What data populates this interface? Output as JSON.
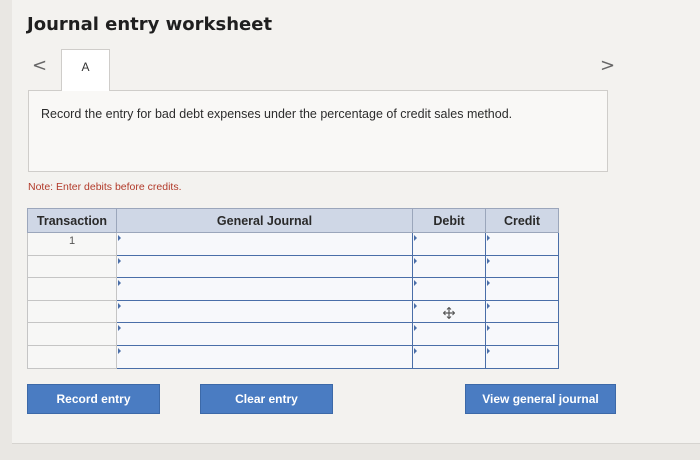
{
  "worksheet": {
    "title": "Journal entry worksheet",
    "prev_arrow": "<",
    "next_arrow": ">",
    "tab_label": "A",
    "prompt": "Record the entry for bad debt expenses under the percentage of credit sales method.",
    "note": "Note: Enter debits before credits."
  },
  "table": {
    "headers": [
      "Transaction",
      "General Journal",
      "Debit",
      "Credit"
    ],
    "rows": [
      {
        "transaction": "1",
        "account": "",
        "debit": "",
        "credit": ""
      },
      {
        "transaction": "",
        "account": "",
        "debit": "",
        "credit": ""
      },
      {
        "transaction": "",
        "account": "",
        "debit": "",
        "credit": ""
      },
      {
        "transaction": "",
        "account": "",
        "debit": "",
        "credit": ""
      },
      {
        "transaction": "",
        "account": "",
        "debit": "",
        "credit": ""
      },
      {
        "transaction": "",
        "account": "",
        "debit": "",
        "credit": ""
      }
    ]
  },
  "buttons": {
    "record": "Record entry",
    "clear": "Clear entry",
    "view": "View general journal"
  },
  "colors": {
    "accent": "#4a7cc2",
    "header_bg": "#cfd7e6",
    "note": "#b23a2a"
  },
  "icons": {
    "cursor": "move-cursor-icon"
  }
}
